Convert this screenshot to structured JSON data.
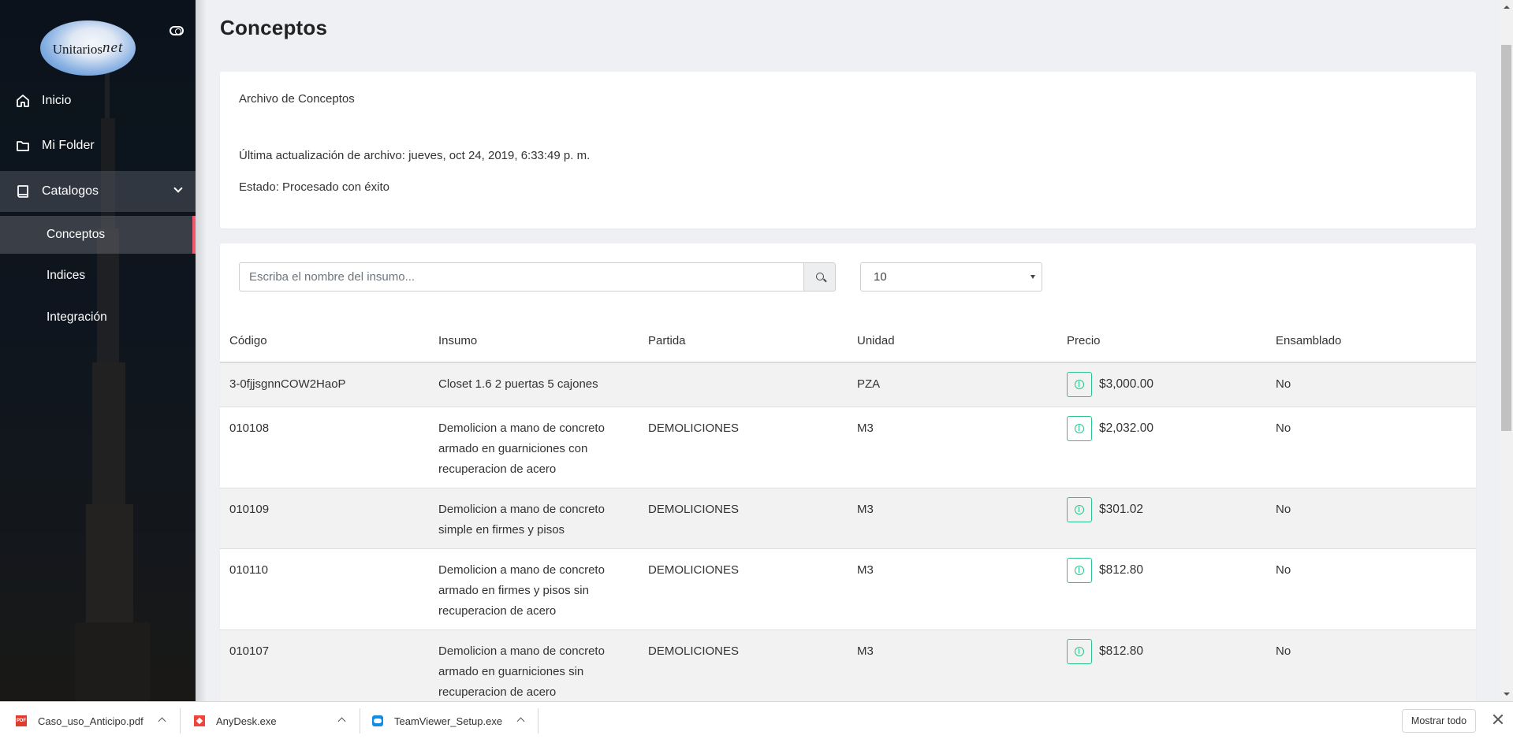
{
  "sidebar": {
    "logo_text": "Unitarios",
    "logo_suffix": "net",
    "nav": [
      {
        "label": "Inicio",
        "icon": "home-icon"
      },
      {
        "label": "Mi Folder",
        "icon": "folder-icon"
      },
      {
        "label": "Catalogos",
        "icon": "book-icon",
        "expanded": true
      }
    ],
    "sub_items": [
      {
        "label": "Conceptos",
        "current": true
      },
      {
        "label": "Indices"
      },
      {
        "label": "Integración"
      }
    ],
    "accent_color": "#f3586d"
  },
  "page": {
    "title": "Conceptos"
  },
  "file_card": {
    "title": "Archivo de Conceptos",
    "last_update": "Última actualización de archivo: jueves, oct 24, 2019, 6:33:49 p. m.",
    "status": "Estado: Procesado con éxito"
  },
  "search": {
    "placeholder": "Escriba el nombre del insumo...",
    "value": ""
  },
  "page_size": {
    "selected": "10"
  },
  "table": {
    "columns": [
      "Código",
      "Insumo",
      "Partida",
      "Unidad",
      "Precio",
      "Ensamblado"
    ],
    "rows": [
      {
        "codigo": "3-0fjjsgnnCOW2HaoP",
        "insumo": "Closet 1.6 2 puertas 5 cajones",
        "partida": "",
        "unidad": "PZA",
        "precio": "$3,000.00",
        "ensamblado": "No"
      },
      {
        "codigo": "010108",
        "insumo": "Demolicion a mano de concreto armado en guarniciones con recuperacion de acero",
        "partida": "DEMOLICIONES",
        "unidad": "M3",
        "precio": "$2,032.00",
        "ensamblado": "No"
      },
      {
        "codigo": "010109",
        "insumo": "Demolicion a mano de concreto simple en firmes y pisos",
        "partida": "DEMOLICIONES",
        "unidad": "M3",
        "precio": "$301.02",
        "ensamblado": "No"
      },
      {
        "codigo": "010110",
        "insumo": "Demolicion a mano de concreto armado en firmes y pisos sin recuperacion de acero",
        "partida": "DEMOLICIONES",
        "unidad": "M3",
        "precio": "$812.80",
        "ensamblado": "No"
      },
      {
        "codigo": "010107",
        "insumo": "Demolicion a mano de concreto armado en guarniciones sin recuperacion de acero",
        "partida": "DEMOLICIONES",
        "unidad": "M3",
        "precio": "$812.80",
        "ensamblado": "No"
      }
    ],
    "info_button_color": "#2bc48a"
  },
  "downloads": {
    "items": [
      {
        "name": "Caso_uso_Anticipo.pdf",
        "icon": "pdf-icon"
      },
      {
        "name": "AnyDesk.exe",
        "icon": "anydesk-icon"
      },
      {
        "name": "TeamViewer_Setup.exe",
        "icon": "teamviewer-icon"
      }
    ],
    "show_all_label": "Mostrar todo"
  }
}
